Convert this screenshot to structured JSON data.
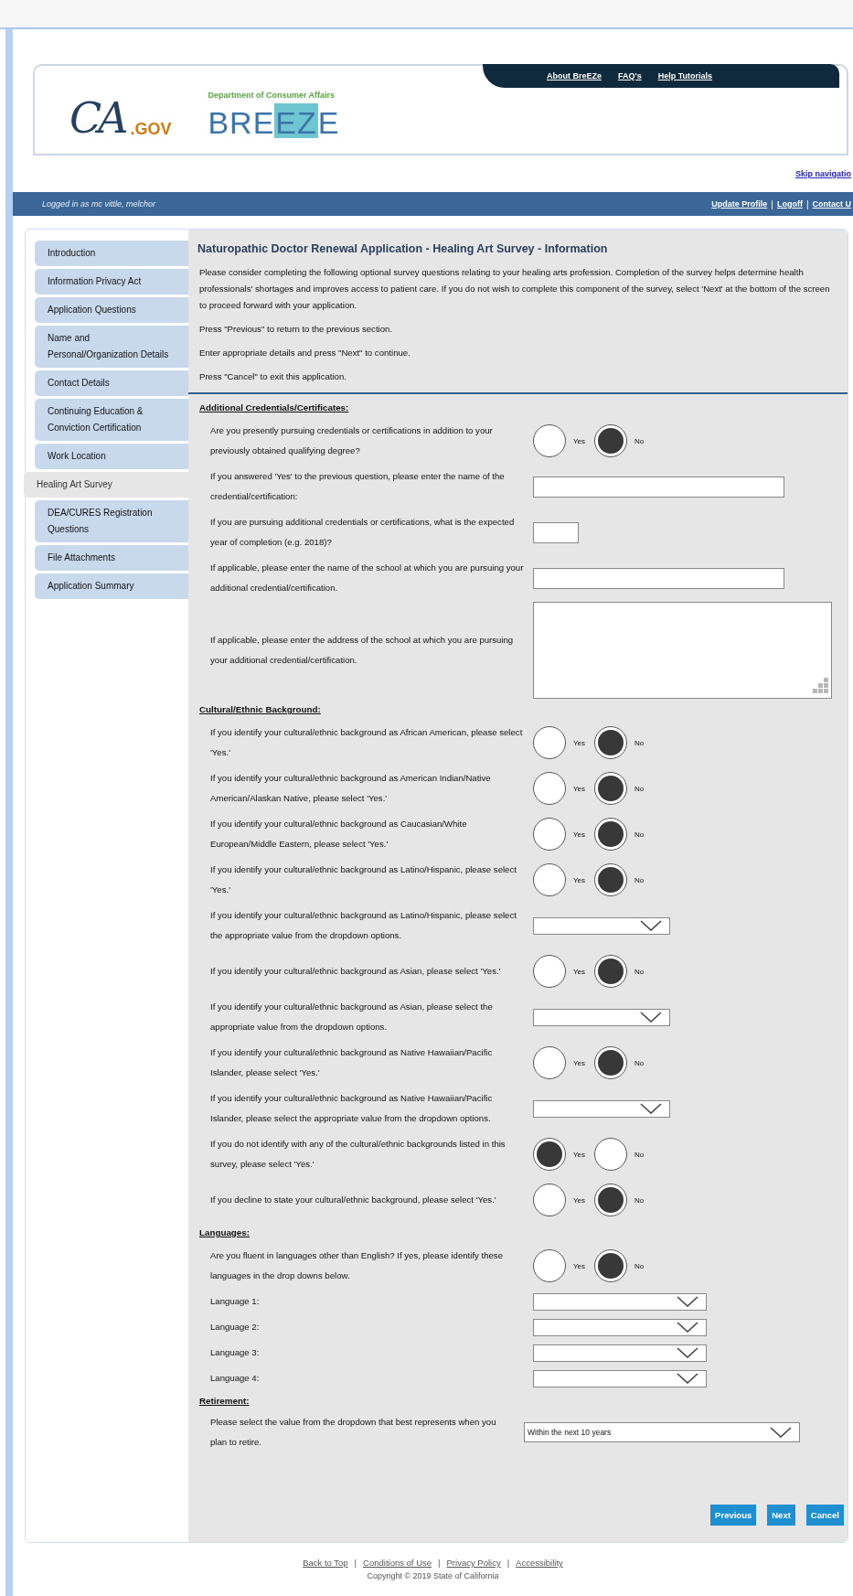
{
  "header": {
    "ca_logo": {
      "mark": "CA",
      "suffix": ".GOV"
    },
    "department": "Department of Consumer Affairs",
    "breeze_logo": {
      "lead": "BRE",
      "highlight": "EZ",
      "tail": "E"
    },
    "top_links": [
      "About BreEZe",
      "FAQ's",
      "Help Tutorials"
    ],
    "skip_link": "Skip navigatio"
  },
  "user_bar": {
    "logged_in": "Logged in as mc vittle, melchor",
    "links": [
      "Update Profile",
      "Logoff",
      "Contact U"
    ],
    "separator": "|"
  },
  "sidebar": {
    "items": [
      {
        "label": "Introduction",
        "selected": false
      },
      {
        "label": "Information Privacy Act",
        "selected": false
      },
      {
        "label": "Application Questions",
        "selected": false
      },
      {
        "label": "Name and Personal/Organization Details",
        "selected": false
      },
      {
        "label": "Contact Details",
        "selected": false
      },
      {
        "label": "Continuing Education & Conviction Certification",
        "selected": false
      },
      {
        "label": "Work Location",
        "selected": false
      },
      {
        "label": "Healing Art Survey",
        "selected": true
      },
      {
        "label": "DEA/CURES Registration Questions",
        "selected": false
      },
      {
        "label": "File Attachments",
        "selected": false
      },
      {
        "label": "Application Summary",
        "selected": false
      }
    ]
  },
  "page": {
    "title": "Naturopathic Doctor Renewal Application - Healing Art Survey - Information",
    "intro": [
      "Please consider completing the following optional survey questions relating to your healing arts profession. Completion of the survey helps determine health professionals' shortages and improves access to patient care. If you do not wish to complete this component of the survey, select 'Next' at the bottom of the screen to proceed forward with your application.",
      "Press \"Previous\" to return to the previous section.",
      "Enter appropriate details and press \"Next\" to continue.",
      "Press \"Cancel\" to exit this application."
    ],
    "sections": [
      {
        "heading": "Additional Credentials/Certificates:",
        "rows": [
          {
            "kind": "radio",
            "question": "Are you presently pursuing credentials or certifications in addition to your previously obtained qualifying degree?",
            "options": [
              {
                "label": "Yes",
                "selected": false
              },
              {
                "label": "No",
                "selected": true
              }
            ]
          },
          {
            "kind": "text",
            "question": "If you answered 'Yes' to the previous question, please enter the name of the credential/certification:"
          },
          {
            "kind": "year",
            "question": "If you are pursuing additional credentials or certifications, what is the expected year of completion (e.g. 2018)?"
          },
          {
            "kind": "text",
            "question": "If applicable, please enter the name of the school at which you are pursuing your additional credential/certification."
          },
          {
            "kind": "textarea",
            "question": "If applicable, please enter the address of the school at which you are pursuing your additional credential/certification."
          }
        ]
      },
      {
        "heading": "Cultural/Ethnic Background:",
        "rows": [
          {
            "kind": "radio",
            "question": "If you identify your cultural/ethnic background as African American, please select 'Yes.'",
            "options": [
              {
                "label": "Yes",
                "selected": false
              },
              {
                "label": "No",
                "selected": true
              }
            ]
          },
          {
            "kind": "radio",
            "question": "If you identify your cultural/ethnic background as American Indian/Native American/Alaskan Native, please select 'Yes.'",
            "options": [
              {
                "label": "Yes",
                "selected": false
              },
              {
                "label": "No",
                "selected": true
              }
            ]
          },
          {
            "kind": "radio",
            "question": "If you identify your cultural/ethnic background as Caucasian/White European/Middle Eastern, please select 'Yes.'",
            "options": [
              {
                "label": "Yes",
                "selected": false
              },
              {
                "label": "No",
                "selected": true
              }
            ]
          },
          {
            "kind": "radio",
            "question": "If you identify your cultural/ethnic background as Latino/Hispanic, please select 'Yes.'",
            "options": [
              {
                "label": "Yes",
                "selected": false
              },
              {
                "label": "No",
                "selected": true
              }
            ]
          },
          {
            "kind": "select",
            "question": "If you identify your cultural/ethnic background as Latino/Hispanic, please select the appropriate value from the dropdown options."
          },
          {
            "kind": "radio",
            "question": "If you identify your cultural/ethnic background as Asian, please select 'Yes.'",
            "options": [
              {
                "label": "Yes",
                "selected": false
              },
              {
                "label": "No",
                "selected": true
              }
            ]
          },
          {
            "kind": "select",
            "question": "If you identify your cultural/ethnic background as Asian, please select the appropriate value from the dropdown options."
          },
          {
            "kind": "radio",
            "question": "If you identify your cultural/ethnic background as Native Hawaiian/Pacific Islander, please select 'Yes.'",
            "options": [
              {
                "label": "Yes",
                "selected": false
              },
              {
                "label": "No",
                "selected": true
              }
            ]
          },
          {
            "kind": "select",
            "question": "If you identify your cultural/ethnic background as Native Hawaiian/Pacific Islander, please select the appropriate value from the dropdown options."
          },
          {
            "kind": "radio",
            "question": "If you do not identify with any of the cultural/ethnic backgrounds listed in this survey, please select 'Yes.'",
            "options": [
              {
                "label": "Yes",
                "selected": true
              },
              {
                "label": "No",
                "selected": false
              }
            ]
          },
          {
            "kind": "radio",
            "question": "If you decline to state your cultural/ethnic background, please select 'Yes.'",
            "options": [
              {
                "label": "Yes",
                "selected": false
              },
              {
                "label": "No",
                "selected": true
              }
            ]
          }
        ]
      },
      {
        "heading": "Languages:",
        "rows": [
          {
            "kind": "radio",
            "question": "Are you fluent in languages other than English? If yes, please identify these languages in the drop downs below.",
            "options": [
              {
                "label": "Yes",
                "selected": false
              },
              {
                "label": "No",
                "selected": true
              }
            ]
          },
          {
            "kind": "language",
            "question": "Language 1:"
          },
          {
            "kind": "language",
            "question": "Language 2:"
          },
          {
            "kind": "language",
            "question": "Language 3:"
          },
          {
            "kind": "language",
            "question": "Language 4:"
          }
        ]
      },
      {
        "heading": "Retirement:",
        "rows": [
          {
            "kind": "retirement",
            "question": "Please select the value from the dropdown that best represents when you plan to retire.",
            "value": "Within the next 10 years"
          }
        ]
      }
    ],
    "buttons": [
      "Previous",
      "Next",
      "Cancel"
    ]
  },
  "footer": {
    "links": [
      "Back to Top",
      "Conditions of Use",
      "Privacy Policy",
      "Accessibility"
    ],
    "separator": "|",
    "copyright": "Copyright © 2019 State of California"
  }
}
